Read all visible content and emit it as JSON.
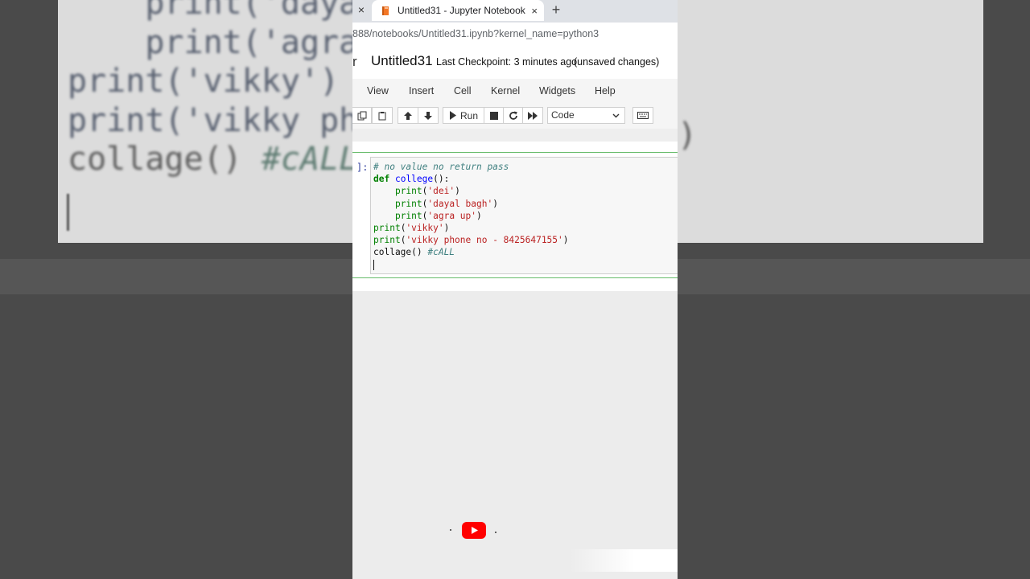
{
  "background_zoom": {
    "code_lines": [
      {
        "indent": "    ",
        "text": "print('dayal"
      },
      {
        "indent": "    ",
        "text": "print('agra u"
      },
      {
        "indent": "",
        "text": "print('vikky')"
      },
      {
        "indent": "",
        "text": "print('vikky pho"
      },
      {
        "indent": "",
        "text": "collage() ",
        "comment": "#cALL"
      }
    ],
    "right_paren": ")"
  },
  "browser": {
    "left_close_glyph": "×",
    "tab": {
      "title": "Untitled31 - Jupyter Notebook",
      "close_glyph": "×"
    },
    "new_tab_glyph": "+",
    "url": "888/notebooks/Untitled31.ipynb?kernel_name=python3"
  },
  "notebook": {
    "logo_fragment": "r",
    "title": "Untitled31",
    "checkpoint": "Last Checkpoint: 3 minutes ago",
    "unsaved": "(unsaved changes)",
    "menu": [
      "View",
      "Insert",
      "Cell",
      "Kernel",
      "Widgets",
      "Help"
    ],
    "toolbar": {
      "run_label": "Run",
      "cell_type": "Code",
      "icons": [
        "copy-icon",
        "paste-icon",
        "arrow-up-icon",
        "arrow-down-icon",
        "run-icon",
        "stop-icon",
        "restart-icon",
        "fast-forward-icon",
        "keyboard-icon"
      ]
    },
    "cell": {
      "prompt": "]:",
      "lines": [
        {
          "comment": "# no value no return pass"
        },
        {
          "kw": "def",
          "name": "college",
          "rest": "():"
        },
        {
          "indent": "    ",
          "builtin": "print",
          "open": "(",
          "str": "'dei'",
          "close": ")"
        },
        {
          "indent": "    ",
          "builtin": "print",
          "open": "(",
          "str": "'dayal bagh'",
          "close": ")"
        },
        {
          "indent": "    ",
          "builtin": "print",
          "open": "(",
          "str": "'agra up'",
          "close": ")"
        },
        {
          "indent": "",
          "builtin": "print",
          "open": "(",
          "str": "'vikky'",
          "close": ")"
        },
        {
          "indent": "",
          "builtin": "print",
          "open": "(",
          "str": "'vikky phone no - 8425647155'",
          "close": ")"
        },
        {
          "plain": "collage() ",
          "comment": "#cALL"
        }
      ]
    }
  },
  "colors": {
    "cell_border_selected": "#66bb6a",
    "youtube_red": "#ff0000"
  }
}
